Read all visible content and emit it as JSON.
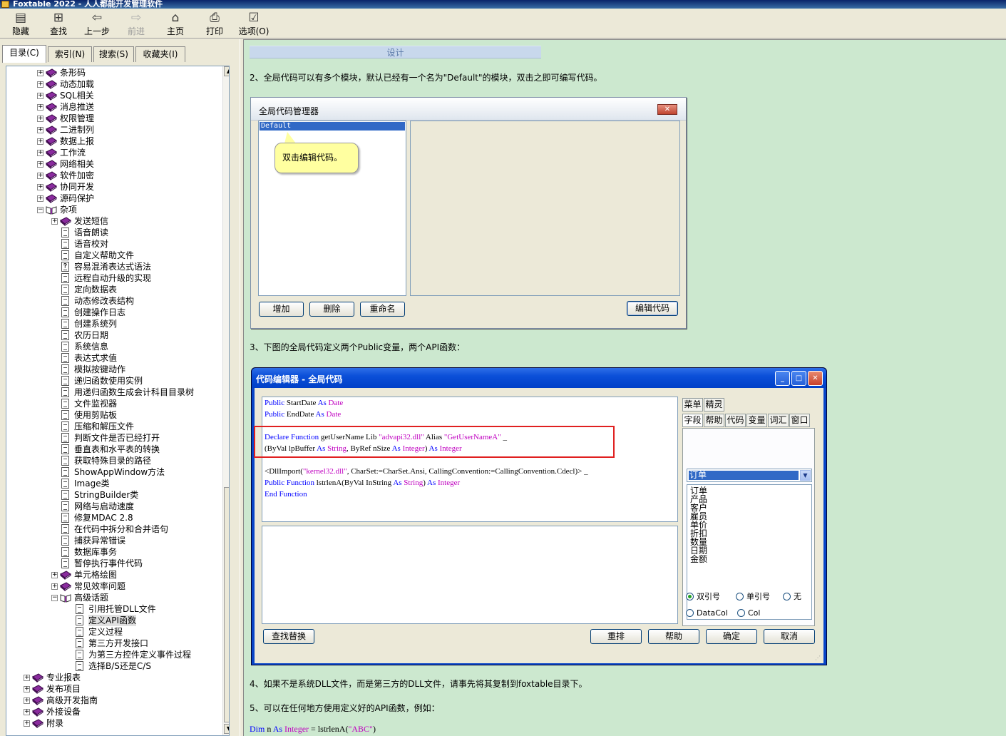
{
  "window": {
    "title": "Foxtable 2022 - 人人都能开发管理软件"
  },
  "toolbar": [
    {
      "name": "hide-button",
      "icon": "hide-icon",
      "glyph": "▤",
      "label": "隐藏",
      "enabled": true
    },
    {
      "name": "find-button",
      "icon": "find-icon",
      "glyph": "⊞",
      "label": "查找",
      "enabled": true
    },
    {
      "name": "back-button",
      "icon": "back-arrow-icon",
      "glyph": "⇦",
      "label": "上一步",
      "enabled": true
    },
    {
      "name": "forward-button",
      "icon": "forward-arrow-icon",
      "glyph": "⇨",
      "label": "前进",
      "enabled": false
    },
    {
      "name": "home-button",
      "icon": "home-icon",
      "glyph": "⌂",
      "label": "主页",
      "enabled": true
    },
    {
      "name": "print-button",
      "icon": "print-icon",
      "glyph": "⎙",
      "label": "打印",
      "enabled": true
    },
    {
      "name": "options-button",
      "icon": "options-icon",
      "glyph": "☑",
      "label": "选项(O)",
      "enabled": true
    }
  ],
  "nav_tabs": [
    {
      "label": "目录(C)",
      "active": true
    },
    {
      "label": "索引(N)",
      "active": false
    },
    {
      "label": "搜索(S)",
      "active": false
    },
    {
      "label": "收藏夹(I)",
      "active": false
    }
  ],
  "tree": [
    {
      "label": "条形码",
      "level": 1,
      "type": "book",
      "pm": "+"
    },
    {
      "label": "动态加载",
      "level": 1,
      "type": "book",
      "pm": "+"
    },
    {
      "label": "SQL相关",
      "level": 1,
      "type": "book",
      "pm": "+"
    },
    {
      "label": "消息推送",
      "level": 1,
      "type": "book",
      "pm": "+"
    },
    {
      "label": "权限管理",
      "level": 1,
      "type": "book",
      "pm": "+"
    },
    {
      "label": "二进制列",
      "level": 1,
      "type": "book",
      "pm": "+"
    },
    {
      "label": "数据上报",
      "level": 1,
      "type": "book",
      "pm": "+"
    },
    {
      "label": "工作流",
      "level": 1,
      "type": "book",
      "pm": "+"
    },
    {
      "label": "网络相关",
      "level": 1,
      "type": "book",
      "pm": "+"
    },
    {
      "label": "软件加密",
      "level": 1,
      "type": "book",
      "pm": "+"
    },
    {
      "label": "协同开发",
      "level": 1,
      "type": "book",
      "pm": "+"
    },
    {
      "label": "源码保护",
      "level": 1,
      "type": "book",
      "pm": "+"
    },
    {
      "label": "杂项",
      "level": 1,
      "type": "openbook",
      "pm": "-"
    },
    {
      "label": "发送短信",
      "level": 2,
      "type": "book",
      "pm": "+"
    },
    {
      "label": "语音朗读",
      "level": 2,
      "type": "page"
    },
    {
      "label": "语音校对",
      "level": 2,
      "type": "page"
    },
    {
      "label": "自定义帮助文件",
      "level": 2,
      "type": "page"
    },
    {
      "label": "容易混淆表达式语法",
      "level": 2,
      "type": "question"
    },
    {
      "label": "远程自动升级的实现",
      "level": 2,
      "type": "page"
    },
    {
      "label": "定向数据表",
      "level": 2,
      "type": "page"
    },
    {
      "label": "动态修改表结构",
      "level": 2,
      "type": "page"
    },
    {
      "label": "创建操作日志",
      "level": 2,
      "type": "page"
    },
    {
      "label": "创建系统列",
      "level": 2,
      "type": "page"
    },
    {
      "label": "农历日期",
      "level": 2,
      "type": "page"
    },
    {
      "label": "系统信息",
      "level": 2,
      "type": "page"
    },
    {
      "label": "表达式求值",
      "level": 2,
      "type": "page"
    },
    {
      "label": "模拟按键动作",
      "level": 2,
      "type": "page"
    },
    {
      "label": "递归函数使用实例",
      "level": 2,
      "type": "page"
    },
    {
      "label": "用递归函数生成会计科目目录树",
      "level": 2,
      "type": "page"
    },
    {
      "label": "文件监视器",
      "level": 2,
      "type": "page"
    },
    {
      "label": "使用剪贴板",
      "level": 2,
      "type": "page"
    },
    {
      "label": "压缩和解压文件",
      "level": 2,
      "type": "page"
    },
    {
      "label": "判断文件是否已经打开",
      "level": 2,
      "type": "page"
    },
    {
      "label": "垂直表和水平表的转换",
      "level": 2,
      "type": "page"
    },
    {
      "label": "获取特殊目录的路径",
      "level": 2,
      "type": "page"
    },
    {
      "label": "ShowAppWindow方法",
      "level": 2,
      "type": "page"
    },
    {
      "label": "Image类",
      "level": 2,
      "type": "page"
    },
    {
      "label": "StringBuilder类",
      "level": 2,
      "type": "page"
    },
    {
      "label": "网络与启动速度",
      "level": 2,
      "type": "page"
    },
    {
      "label": "修复MDAC 2.8",
      "level": 2,
      "type": "page"
    },
    {
      "label": "在代码中拆分和合并语句",
      "level": 2,
      "type": "page"
    },
    {
      "label": "捕获异常错误",
      "level": 2,
      "type": "page"
    },
    {
      "label": "数据库事务",
      "level": 2,
      "type": "page"
    },
    {
      "label": "暂停执行事件代码",
      "level": 2,
      "type": "page"
    },
    {
      "label": "单元格绘图",
      "level": 2,
      "type": "book",
      "pm": "+"
    },
    {
      "label": "常见效率问题",
      "level": 2,
      "type": "book",
      "pm": "+"
    },
    {
      "label": "高级话题",
      "level": 2,
      "type": "openbook",
      "pm": "-"
    },
    {
      "label": "引用托管DLL文件",
      "level": 3,
      "type": "page"
    },
    {
      "label": "定义API函数",
      "level": 3,
      "type": "page",
      "selected": true
    },
    {
      "label": "定义过程",
      "level": 3,
      "type": "page"
    },
    {
      "label": "第三方开发接口",
      "level": 3,
      "type": "page"
    },
    {
      "label": "为第三方控件定义事件过程",
      "level": 3,
      "type": "page"
    },
    {
      "label": "选择B/S还是C/S",
      "level": 3,
      "type": "page"
    },
    {
      "label": "专业报表",
      "level": 0,
      "type": "book",
      "pm": "+"
    },
    {
      "label": "发布项目",
      "level": 0,
      "type": "book",
      "pm": "+"
    },
    {
      "label": "高级开发指南",
      "level": 0,
      "type": "book",
      "pm": "+"
    },
    {
      "label": "外接设备",
      "level": 0,
      "type": "book",
      "pm": "+"
    },
    {
      "label": "附录",
      "level": 0,
      "type": "book",
      "pm": "+"
    }
  ],
  "content": {
    "design_bar": "设计",
    "para2": "2、全局代码可以有多个模块，默认已经有一个名为\"Default\"的模块，双击之即可编写代码。",
    "para3": "3、下图的全局代码定义两个Public变量，两个API函数：",
    "para4": "4、如果不是系统DLL文件，而是第三方的DLL文件，请事先将其复制到foxtable目录下。",
    "para5": "5、可以在任何地方使用定义好的API函数，例如：",
    "example": {
      "kw1": "Dim",
      "var": "n",
      "kw2": "As",
      "type": "Integer",
      "rest": "= lstrlenA(",
      "str": "\"ABC\"",
      "close": ")"
    }
  },
  "global_code_manager": {
    "title": "全局代码管理器",
    "close_glyph": "✕",
    "modules": [
      "Default"
    ],
    "balloon": "双击编辑代码。",
    "add": "增加",
    "delete": "删除",
    "rename": "重命名",
    "edit": "编辑代码"
  },
  "code_editor": {
    "title": "代码编辑器 - 全局代码",
    "min_glyph": "_",
    "max_glyph": "□",
    "close_glyph": "✕",
    "lines": [
      [
        {
          "t": "Public",
          "c": "kw"
        },
        {
          "t": " StartDate "
        },
        {
          "t": "As",
          "c": "kw"
        },
        {
          "t": " "
        },
        {
          "t": "Date",
          "c": "ty"
        }
      ],
      [
        {
          "t": "Public",
          "c": "kw"
        },
        {
          "t": " EndDate "
        },
        {
          "t": "As",
          "c": "kw"
        },
        {
          "t": " "
        },
        {
          "t": "Date",
          "c": "ty"
        }
      ],
      [],
      [
        {
          "t": "Declare",
          "c": "kw"
        },
        {
          "t": " "
        },
        {
          "t": "Function",
          "c": "kw"
        },
        {
          "t": " getUserName Lib "
        },
        {
          "t": "\"advapi32.dll\"",
          "c": "st"
        },
        {
          "t": " Alias "
        },
        {
          "t": "\"GetUserNameA\"",
          "c": "st"
        },
        {
          "t": " _"
        }
      ],
      [
        {
          "t": "(ByVal lpBuffer "
        },
        {
          "t": "As",
          "c": "kw"
        },
        {
          "t": " "
        },
        {
          "t": "String",
          "c": "ty"
        },
        {
          "t": ", ByRef nSize "
        },
        {
          "t": "As",
          "c": "kw"
        },
        {
          "t": " "
        },
        {
          "t": "Integer",
          "c": "ty"
        },
        {
          "t": ") "
        },
        {
          "t": "As",
          "c": "kw"
        },
        {
          "t": " "
        },
        {
          "t": "Integer",
          "c": "ty"
        }
      ],
      [],
      [
        {
          "t": "<DllImport("
        },
        {
          "t": "\"kernel32.dll\"",
          "c": "st"
        },
        {
          "t": ", CharSet:=CharSet.Ansi, CallingConvention:=CallingConvention.Cdecl)> _"
        }
      ],
      [
        {
          "t": "Public",
          "c": "kw"
        },
        {
          "t": " "
        },
        {
          "t": "Function",
          "c": "kw"
        },
        {
          "t": " lstrlenA(ByVal InString "
        },
        {
          "t": "As",
          "c": "kw"
        },
        {
          "t": " "
        },
        {
          "t": "String",
          "c": "ty"
        },
        {
          "t": ") "
        },
        {
          "t": "As",
          "c": "kw"
        },
        {
          "t": " "
        },
        {
          "t": "Integer",
          "c": "ty"
        }
      ],
      [
        {
          "t": "End",
          "c": "kw"
        },
        {
          "t": " "
        },
        {
          "t": "Function",
          "c": "kw"
        }
      ]
    ],
    "tabs_row1": [
      "菜单",
      "精灵"
    ],
    "tabs_row2": [
      "字段",
      "帮助",
      "代码",
      "变量",
      "词汇",
      "窗口"
    ],
    "table_select": "订单",
    "combo_arrow": "▼",
    "fields": [
      "订单",
      "产品",
      "客户",
      "雇员",
      "单价",
      "折扣",
      "数量",
      "日期",
      "金额"
    ],
    "quote_options": [
      {
        "label": "双引号",
        "checked": true
      },
      {
        "label": "单引号",
        "checked": false
      },
      {
        "label": "无",
        "checked": false
      }
    ],
    "col_options": [
      {
        "label": "DataCol",
        "checked": false
      },
      {
        "label": "Col",
        "checked": false
      }
    ],
    "find_replace": "查找替换",
    "rearrange": "重排",
    "help": "帮助",
    "ok": "确定",
    "cancel": "取消"
  }
}
